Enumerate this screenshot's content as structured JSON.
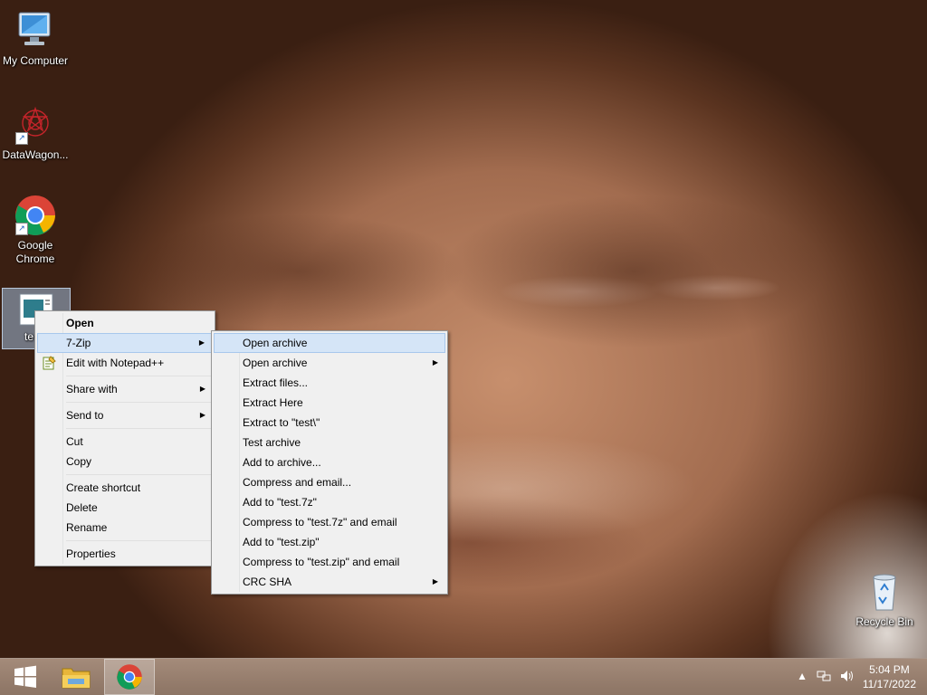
{
  "desktop": {
    "icons": [
      {
        "label": "My Computer"
      },
      {
        "label": "DataWagon..."
      },
      {
        "label": "Google Chrome"
      },
      {
        "label": "te"
      },
      {
        "label": "Recycle Bin"
      }
    ]
  },
  "context_menu": {
    "items": {
      "open": "Open",
      "seven_zip": "7-Zip",
      "edit_notepad": "Edit with Notepad++",
      "share_with": "Share with",
      "send_to": "Send to",
      "cut": "Cut",
      "copy": "Copy",
      "create_shortcut": "Create shortcut",
      "delete": "Delete",
      "rename": "Rename",
      "properties": "Properties"
    }
  },
  "submenu_7zip": {
    "items": [
      {
        "label": "Open archive",
        "highlighted": true,
        "has_submenu": false
      },
      {
        "label": "Open archive",
        "has_submenu": true
      },
      {
        "label": "Extract files...",
        "has_submenu": false
      },
      {
        "label": "Extract Here",
        "has_submenu": false
      },
      {
        "label": "Extract to \"test\\\"",
        "has_submenu": false
      },
      {
        "label": "Test archive",
        "has_submenu": false
      },
      {
        "label": "Add to archive...",
        "has_submenu": false
      },
      {
        "label": "Compress and email...",
        "has_submenu": false
      },
      {
        "label": "Add to \"test.7z\"",
        "has_submenu": false
      },
      {
        "label": "Compress to \"test.7z\" and email",
        "has_submenu": false
      },
      {
        "label": "Add to \"test.zip\"",
        "has_submenu": false
      },
      {
        "label": "Compress to \"test.zip\" and email",
        "has_submenu": false
      },
      {
        "label": "CRC SHA",
        "has_submenu": true
      }
    ]
  },
  "taskbar": {
    "time": "5:04 PM",
    "date": "11/17/2022",
    "tray_icons": [
      "show-hidden-icons",
      "network-icon",
      "volume-icon"
    ]
  },
  "colors": {
    "menu_bg": "#f0f0f0",
    "highlight": "#d5e5f7",
    "highlight_border": "#a8c8ec"
  }
}
